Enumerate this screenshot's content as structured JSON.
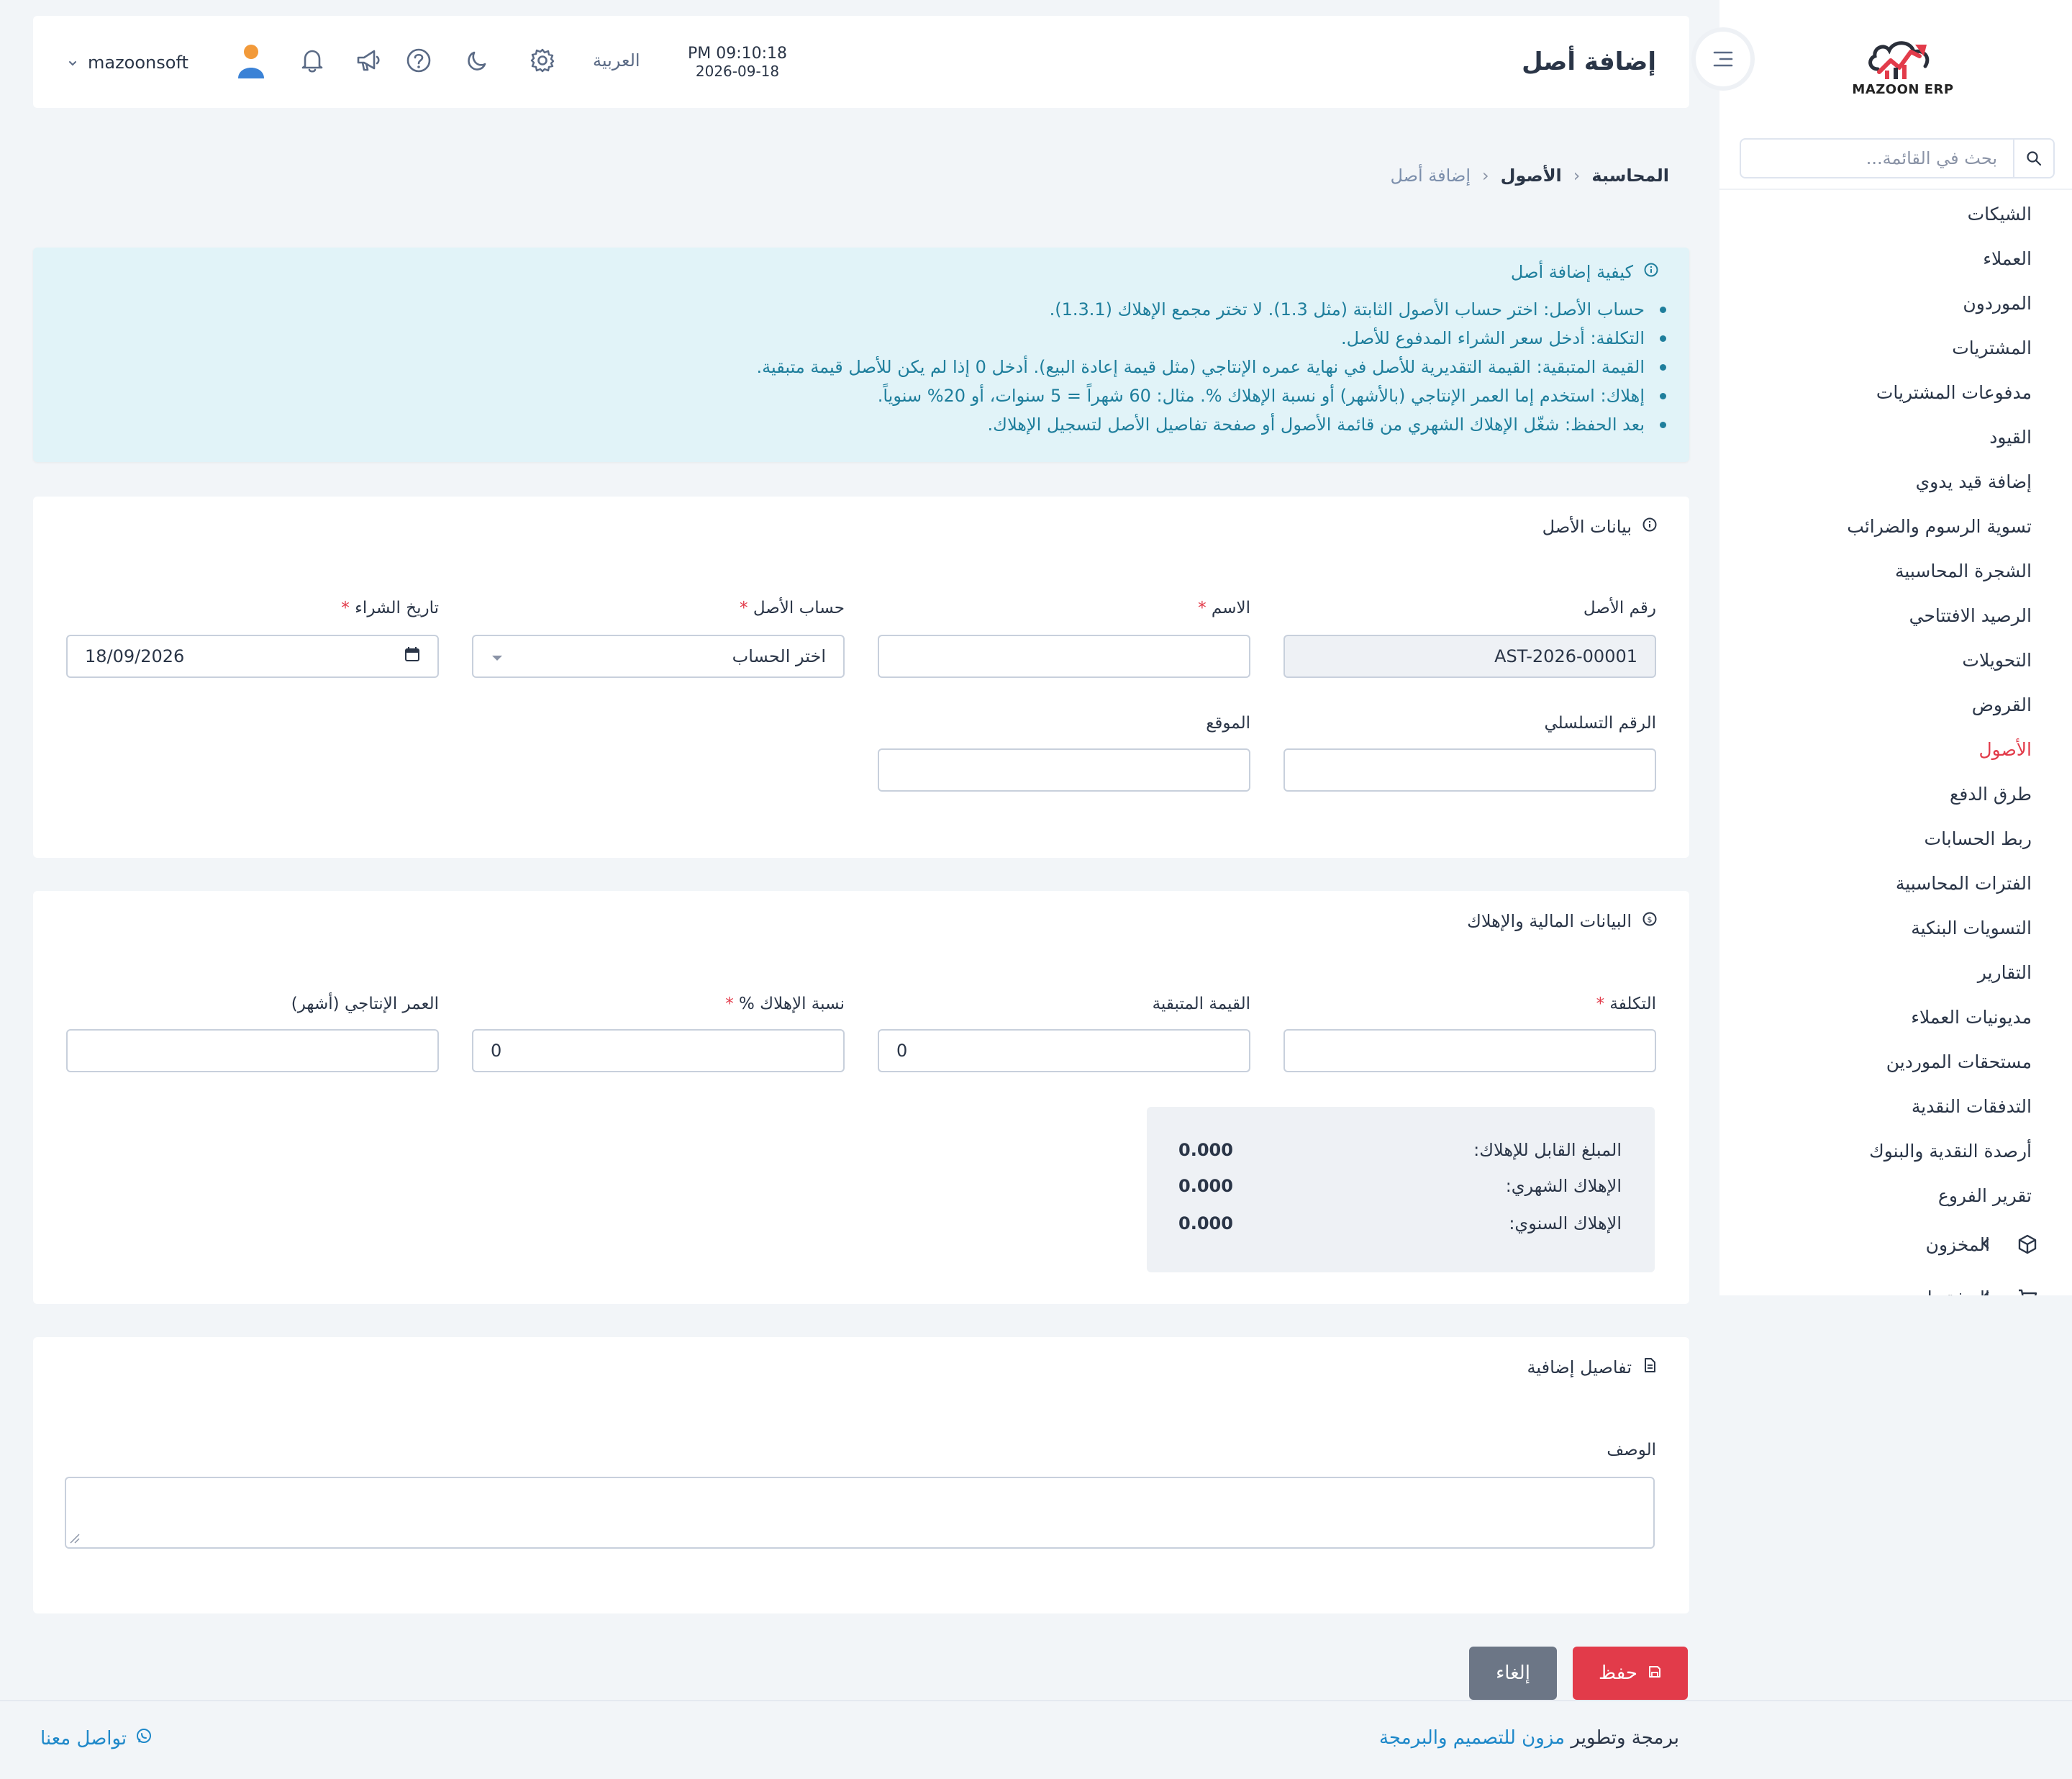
{
  "brand": {
    "name": "MAZOON ERP"
  },
  "sidebar": {
    "search_placeholder": "بحث في القائمة...",
    "items": [
      {
        "label": "الشيكات"
      },
      {
        "label": "العملاء"
      },
      {
        "label": "الموردون"
      },
      {
        "label": "المشتريات"
      },
      {
        "label": "مدفوعات المشتريات"
      },
      {
        "label": "القيود"
      },
      {
        "label": "إضافة قيد يدوي"
      },
      {
        "label": "تسوية الرسوم والضرائب"
      },
      {
        "label": "الشجرة المحاسبية"
      },
      {
        "label": "الرصيد الافتتاحي"
      },
      {
        "label": "التحويلات"
      },
      {
        "label": "القروض"
      },
      {
        "label": "الأصول",
        "active": true
      },
      {
        "label": "طرق الدفع"
      },
      {
        "label": "ربط الحسابات"
      },
      {
        "label": "الفترات المحاسبية"
      },
      {
        "label": "التسويات البنكية"
      },
      {
        "label": "التقارير"
      },
      {
        "label": "مديونيات العملاء"
      },
      {
        "label": "مستحقات الموردين"
      },
      {
        "label": "التدفقات النقدية"
      },
      {
        "label": "أرصدة النقدية والبنوك"
      },
      {
        "label": "تقرير الفروع"
      }
    ],
    "groups": [
      {
        "label": "المخزون",
        "icon": "box-icon"
      },
      {
        "label": "المشتريات",
        "icon": "cart-icon"
      }
    ]
  },
  "header": {
    "title": "إضافة أصل",
    "time": "PM 09:10:18",
    "date": "2026-09-18",
    "language": "العربية",
    "username": "mazoonsoft"
  },
  "breadcrumb": [
    "المحاسبة",
    "الأصول",
    "إضافة أصل"
  ],
  "info": {
    "title": "كيفية إضافة أصل",
    "items": [
      "حساب الأصل: اختر حساب الأصول الثابتة (مثل 1.3). لا تختر مجمع الإهلاك (1.3.1).",
      "التكلفة: أدخل سعر الشراء المدفوع للأصل.",
      "القيمة المتبقية: القيمة التقديرية للأصل في نهاية عمره الإنتاجي (مثل قيمة إعادة البيع). أدخل 0 إذا لم يكن للأصل قيمة متبقية.",
      "إهلاك: استخدم إما العمر الإنتاجي (بالأشهر) أو نسبة الإهلاك %. مثال: 60 شهراً = 5 سنوات، أو 20% سنوياً.",
      "بعد الحفظ: شغّل الإهلاك الشهري من قائمة الأصول أو صفحة تفاصيل الأصل لتسجيل الإهلاك."
    ]
  },
  "asset_card": {
    "title": "بيانات الأصل",
    "asset_no_label": "رقم الأصل",
    "asset_no_value": "AST-2026-00001",
    "name_label": "الاسم",
    "account_label": "حساب الأصل",
    "account_placeholder": "اختر الحساب",
    "purchase_date_label": "تاريخ الشراء",
    "purchase_date_value": "18/09/2026",
    "serial_label": "الرقم التسلسلي",
    "location_label": "الموقع"
  },
  "financial_card": {
    "title": "البيانات المالية والإهلاك",
    "cost_label": "التكلفة",
    "residual_label": "القيمة المتبقية",
    "residual_value": "0",
    "rate_label": "نسبة الإهلاك %",
    "rate_value": "0",
    "life_label": "العمر الإنتاجي (أشهر)",
    "summary": [
      {
        "label": "المبلغ القابل للإهلاك:",
        "value": "0.000"
      },
      {
        "label": "الإهلاك الشهري:",
        "value": "0.000"
      },
      {
        "label": "الإهلاك السنوي:",
        "value": "0.000"
      }
    ]
  },
  "extra_card": {
    "title": "تفاصيل إضافية",
    "description_label": "الوصف"
  },
  "actions": {
    "save": "حفظ",
    "cancel": "إلغاء"
  },
  "footer": {
    "credit_prefix": "برمجة وتطوير",
    "credit_link": "مزون للتصميم والبرمجة",
    "contact": "تواصل معنا"
  },
  "colors": {
    "accent": "#e23b4a",
    "info_bg": "#e1f3f8",
    "info_text": "#1e7e9c",
    "link": "#1e88c9"
  }
}
